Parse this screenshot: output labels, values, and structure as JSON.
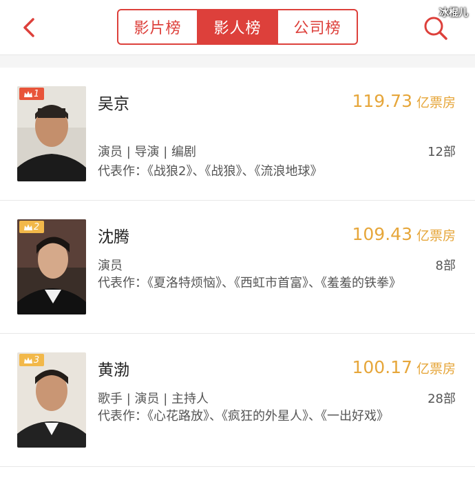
{
  "header": {
    "tabs": [
      {
        "label": "影片榜",
        "active": false
      },
      {
        "label": "影人榜",
        "active": true
      },
      {
        "label": "公司榜",
        "active": false
      }
    ],
    "watermark": "冰棍儿"
  },
  "colors": {
    "accent": "#dd403b",
    "gold": "#e6a63a"
  },
  "people": [
    {
      "rank": "1",
      "name": "吴京",
      "box_office": "119.73",
      "unit": "亿票房",
      "roles": "演员 | 导演 | 编剧",
      "count": "12部",
      "works": "代表作：《战狼2》、《战狼》、《流浪地球》"
    },
    {
      "rank": "2",
      "name": "沈腾",
      "box_office": "109.43",
      "unit": "亿票房",
      "roles": "演员",
      "count": "8部",
      "works": "代表作：《夏洛特烦恼》、《西虹市首富》、《羞羞的铁拳》"
    },
    {
      "rank": "3",
      "name": "黄渤",
      "box_office": "100.17",
      "unit": "亿票房",
      "roles": "歌手 | 演员 | 主持人",
      "count": "28部",
      "works": "代表作：《心花路放》、《疯狂的外星人》、《一出好戏》"
    }
  ]
}
